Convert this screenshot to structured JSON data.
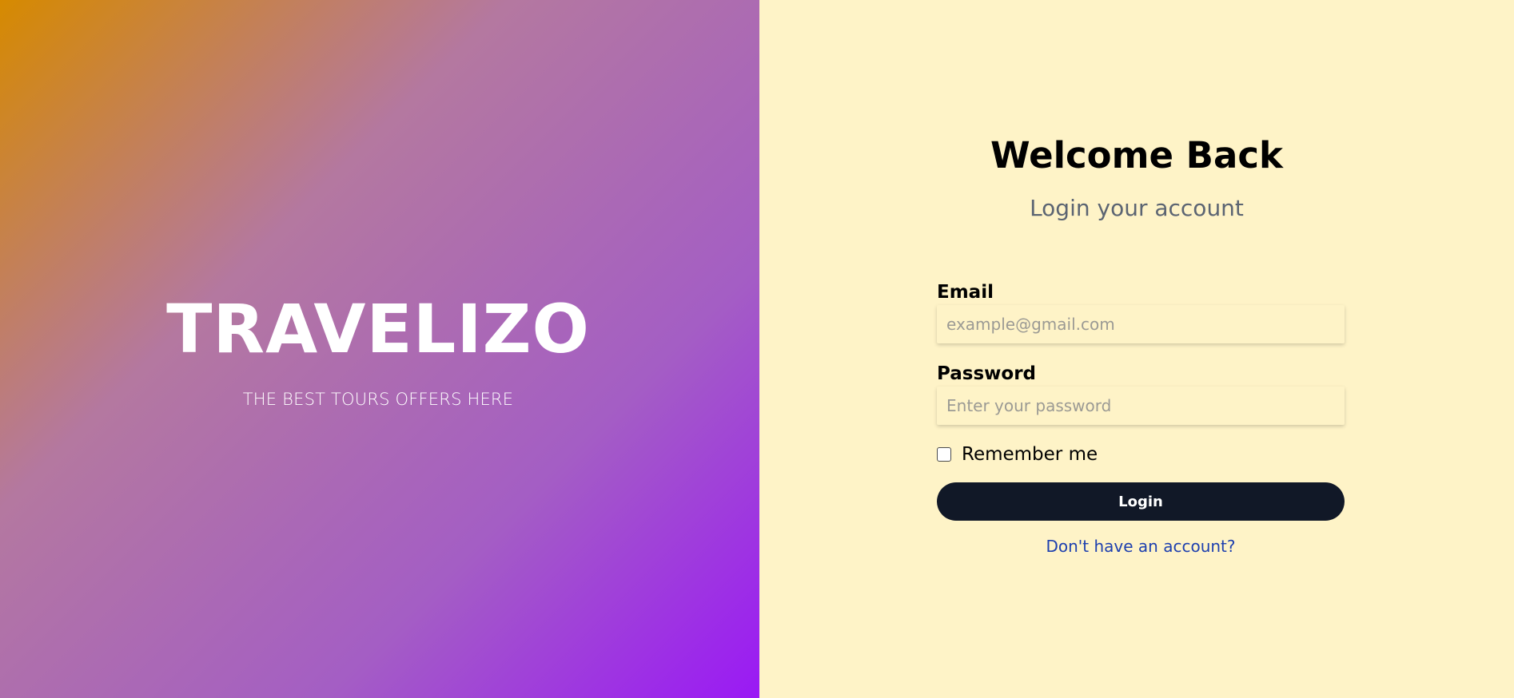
{
  "hero": {
    "brand": "TRAVELIZO",
    "tagline": "THE BEST TOURS OFFERS HERE",
    "gradient_colors": [
      "#d68a00",
      "#b478a0",
      "#a45ec4",
      "#9a19f5"
    ]
  },
  "auth": {
    "title": "Welcome Back",
    "subtitle": "Login your account",
    "email": {
      "label": "Email",
      "value": "",
      "placeholder": "example@gmail.com"
    },
    "password": {
      "label": "Password",
      "value": "",
      "placeholder": "Enter your password"
    },
    "remember_label": "Remember me",
    "remember_checked": false,
    "login_label": "Login",
    "signup_link": "Don't have an account?",
    "background_color": "#fef3c7",
    "button_color": "#111827",
    "link_color": "#1e40af"
  }
}
